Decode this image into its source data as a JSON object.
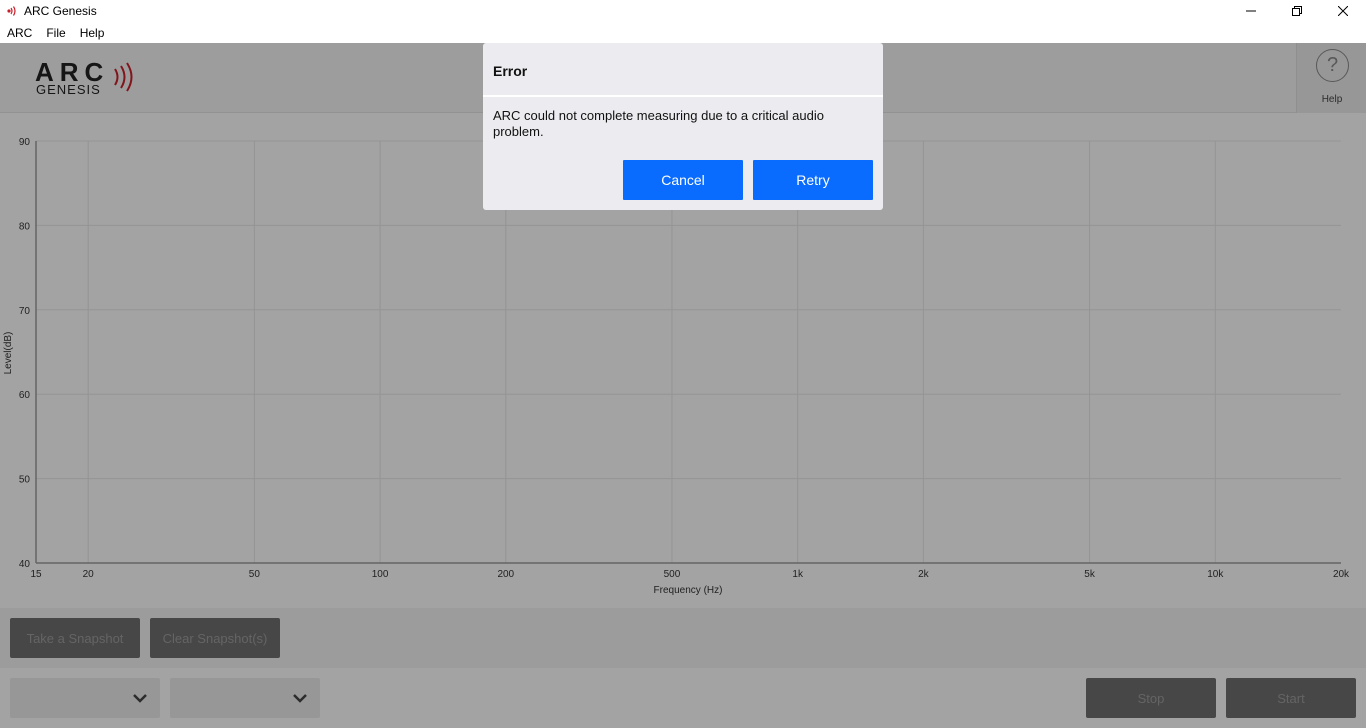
{
  "window": {
    "title": "ARC Genesis"
  },
  "menu": [
    "ARC",
    "File",
    "Help"
  ],
  "header": {
    "logo_main": "ARC",
    "logo_sub": "GENESIS",
    "help_label": "Help"
  },
  "colors": {
    "accent": "#0a6cff",
    "logo_waves": "#c8202a"
  },
  "chart_data": {
    "type": "line",
    "xlabel": "Frequency (Hz)",
    "ylabel": "Level(dB)",
    "x_scale": "log",
    "xlim": [
      15,
      20000
    ],
    "ylim": [
      40,
      90
    ],
    "x_ticks": [
      15,
      20,
      50,
      100,
      200,
      500,
      1000,
      2000,
      5000,
      10000,
      20000
    ],
    "x_tick_labels": [
      "15",
      "20",
      "50",
      "100",
      "200",
      "500",
      "1k",
      "2k",
      "5k",
      "10k",
      "20k"
    ],
    "y_ticks": [
      40,
      50,
      60,
      70,
      80,
      90
    ],
    "y_tick_labels": [
      "40",
      "50",
      "60",
      "70",
      "80",
      "90"
    ],
    "grid": true,
    "series": []
  },
  "snapshot": {
    "take_label": "Take a Snapshot",
    "clear_label": "Clear Snapshot(s)"
  },
  "controls": {
    "stop_label": "Stop",
    "start_label": "Start"
  },
  "dialog": {
    "title": "Error",
    "message": "ARC could not complete measuring due to a critical audio problem.",
    "cancel_label": "Cancel",
    "retry_label": "Retry"
  }
}
